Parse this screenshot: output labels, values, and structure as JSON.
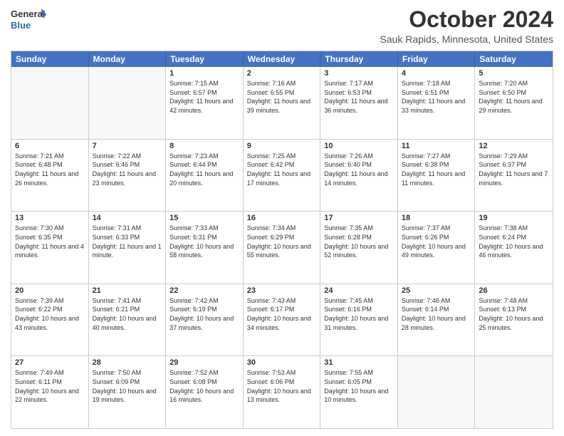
{
  "logo": {
    "line1": "General",
    "line2": "Blue"
  },
  "title": "October 2024",
  "subtitle": "Sauk Rapids, Minnesota, United States",
  "days": [
    "Sunday",
    "Monday",
    "Tuesday",
    "Wednesday",
    "Thursday",
    "Friday",
    "Saturday"
  ],
  "weeks": [
    [
      {
        "day": "",
        "info": ""
      },
      {
        "day": "",
        "info": ""
      },
      {
        "day": "1",
        "info": "Sunrise: 7:15 AM\nSunset: 6:57 PM\nDaylight: 11 hours and 42 minutes."
      },
      {
        "day": "2",
        "info": "Sunrise: 7:16 AM\nSunset: 6:55 PM\nDaylight: 11 hours and 39 minutes."
      },
      {
        "day": "3",
        "info": "Sunrise: 7:17 AM\nSunset: 6:53 PM\nDaylight: 11 hours and 36 minutes."
      },
      {
        "day": "4",
        "info": "Sunrise: 7:18 AM\nSunset: 6:51 PM\nDaylight: 11 hours and 33 minutes."
      },
      {
        "day": "5",
        "info": "Sunrise: 7:20 AM\nSunset: 6:50 PM\nDaylight: 11 hours and 29 minutes."
      }
    ],
    [
      {
        "day": "6",
        "info": "Sunrise: 7:21 AM\nSunset: 6:48 PM\nDaylight: 11 hours and 26 minutes."
      },
      {
        "day": "7",
        "info": "Sunrise: 7:22 AM\nSunset: 6:46 PM\nDaylight: 11 hours and 23 minutes."
      },
      {
        "day": "8",
        "info": "Sunrise: 7:23 AM\nSunset: 6:44 PM\nDaylight: 11 hours and 20 minutes."
      },
      {
        "day": "9",
        "info": "Sunrise: 7:25 AM\nSunset: 6:42 PM\nDaylight: 11 hours and 17 minutes."
      },
      {
        "day": "10",
        "info": "Sunrise: 7:26 AM\nSunset: 6:40 PM\nDaylight: 11 hours and 14 minutes."
      },
      {
        "day": "11",
        "info": "Sunrise: 7:27 AM\nSunset: 6:38 PM\nDaylight: 11 hours and 11 minutes."
      },
      {
        "day": "12",
        "info": "Sunrise: 7:29 AM\nSunset: 6:37 PM\nDaylight: 11 hours and 7 minutes."
      }
    ],
    [
      {
        "day": "13",
        "info": "Sunrise: 7:30 AM\nSunset: 6:35 PM\nDaylight: 11 hours and 4 minutes."
      },
      {
        "day": "14",
        "info": "Sunrise: 7:31 AM\nSunset: 6:33 PM\nDaylight: 11 hours and 1 minute."
      },
      {
        "day": "15",
        "info": "Sunrise: 7:33 AM\nSunset: 6:31 PM\nDaylight: 10 hours and 58 minutes."
      },
      {
        "day": "16",
        "info": "Sunrise: 7:34 AM\nSunset: 6:29 PM\nDaylight: 10 hours and 55 minutes."
      },
      {
        "day": "17",
        "info": "Sunrise: 7:35 AM\nSunset: 6:28 PM\nDaylight: 10 hours and 52 minutes."
      },
      {
        "day": "18",
        "info": "Sunrise: 7:37 AM\nSunset: 6:26 PM\nDaylight: 10 hours and 49 minutes."
      },
      {
        "day": "19",
        "info": "Sunrise: 7:38 AM\nSunset: 6:24 PM\nDaylight: 10 hours and 46 minutes."
      }
    ],
    [
      {
        "day": "20",
        "info": "Sunrise: 7:39 AM\nSunset: 6:22 PM\nDaylight: 10 hours and 43 minutes."
      },
      {
        "day": "21",
        "info": "Sunrise: 7:41 AM\nSunset: 6:21 PM\nDaylight: 10 hours and 40 minutes."
      },
      {
        "day": "22",
        "info": "Sunrise: 7:42 AM\nSunset: 6:19 PM\nDaylight: 10 hours and 37 minutes."
      },
      {
        "day": "23",
        "info": "Sunrise: 7:43 AM\nSunset: 6:17 PM\nDaylight: 10 hours and 34 minutes."
      },
      {
        "day": "24",
        "info": "Sunrise: 7:45 AM\nSunset: 6:16 PM\nDaylight: 10 hours and 31 minutes."
      },
      {
        "day": "25",
        "info": "Sunrise: 7:46 AM\nSunset: 6:14 PM\nDaylight: 10 hours and 28 minutes."
      },
      {
        "day": "26",
        "info": "Sunrise: 7:48 AM\nSunset: 6:13 PM\nDaylight: 10 hours and 25 minutes."
      }
    ],
    [
      {
        "day": "27",
        "info": "Sunrise: 7:49 AM\nSunset: 6:11 PM\nDaylight: 10 hours and 22 minutes."
      },
      {
        "day": "28",
        "info": "Sunrise: 7:50 AM\nSunset: 6:09 PM\nDaylight: 10 hours and 19 minutes."
      },
      {
        "day": "29",
        "info": "Sunrise: 7:52 AM\nSunset: 6:08 PM\nDaylight: 10 hours and 16 minutes."
      },
      {
        "day": "30",
        "info": "Sunrise: 7:53 AM\nSunset: 6:06 PM\nDaylight: 10 hours and 13 minutes."
      },
      {
        "day": "31",
        "info": "Sunrise: 7:55 AM\nSunset: 6:05 PM\nDaylight: 10 hours and 10 minutes."
      },
      {
        "day": "",
        "info": ""
      },
      {
        "day": "",
        "info": ""
      }
    ]
  ]
}
